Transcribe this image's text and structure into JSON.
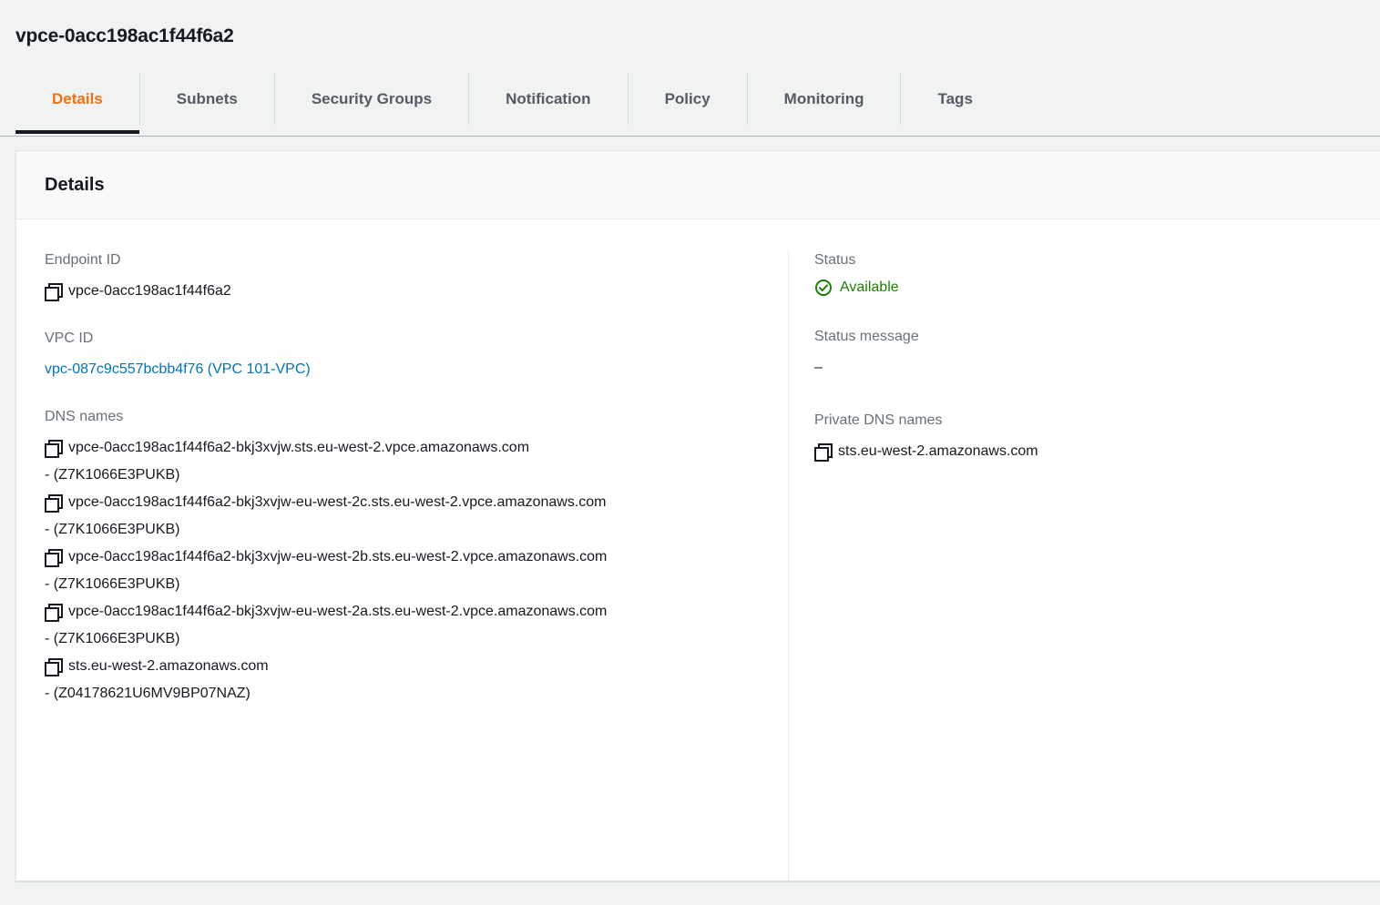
{
  "header": {
    "title": "vpce-0acc198ac1f44f6a2"
  },
  "tabs": [
    {
      "label": "Details",
      "active": true
    },
    {
      "label": "Subnets",
      "active": false
    },
    {
      "label": "Security Groups",
      "active": false
    },
    {
      "label": "Notification",
      "active": false
    },
    {
      "label": "Policy",
      "active": false
    },
    {
      "label": "Monitoring",
      "active": false
    },
    {
      "label": "Tags",
      "active": false
    }
  ],
  "panel": {
    "heading": "Details",
    "left": {
      "endpoint_id": {
        "label": "Endpoint ID",
        "value": "vpce-0acc198ac1f44f6a2",
        "icon": "copy-icon"
      },
      "vpc_id": {
        "label": "VPC ID",
        "value": "vpc-087c9c557bcbb4f76 (VPC 101-VPC)"
      },
      "dns_names": {
        "label": "DNS names",
        "entries": [
          {
            "name": "vpce-0acc198ac1f44f6a2-bkj3xvjw.sts.eu-west-2.vpce.amazonaws.com",
            "zone": "- (Z7K1066E3PUKB)"
          },
          {
            "name": "vpce-0acc198ac1f44f6a2-bkj3xvjw-eu-west-2c.sts.eu-west-2.vpce.amazonaws.com",
            "zone": "- (Z7K1066E3PUKB)"
          },
          {
            "name": "vpce-0acc198ac1f44f6a2-bkj3xvjw-eu-west-2b.sts.eu-west-2.vpce.amazonaws.com",
            "zone": "- (Z7K1066E3PUKB)"
          },
          {
            "name": "vpce-0acc198ac1f44f6a2-bkj3xvjw-eu-west-2a.sts.eu-west-2.vpce.amazonaws.com",
            "zone": "- (Z7K1066E3PUKB)"
          },
          {
            "name": "sts.eu-west-2.amazonaws.com",
            "zone": "- (Z04178621U6MV9BP07NAZ)"
          }
        ]
      }
    },
    "right": {
      "status": {
        "label": "Status",
        "value": "Available",
        "icon": "status-check-circle-icon"
      },
      "status_message": {
        "label": "Status message",
        "value": "–"
      },
      "private_dns_names": {
        "label": "Private DNS names",
        "entries": [
          {
            "name": "sts.eu-west-2.amazonaws.com"
          }
        ]
      }
    }
  },
  "colors": {
    "accent": "#ec7211",
    "link": "#0073bb",
    "success": "#1d8102",
    "label": "#687078",
    "text": "#16191f",
    "page_bg": "#f1f3f3"
  }
}
